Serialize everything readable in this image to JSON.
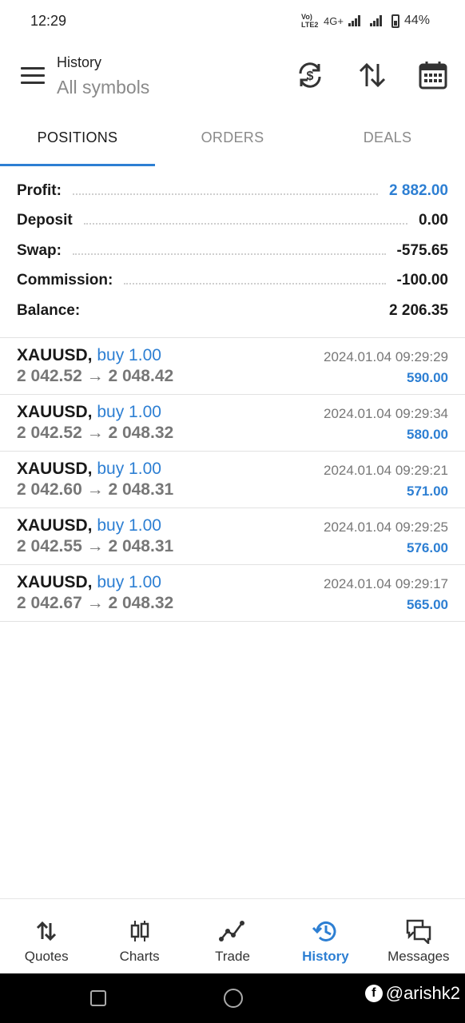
{
  "status_bar": {
    "time": "12:29",
    "network_label": "Vo) LTE2",
    "network_type": "4G+",
    "battery": "44%"
  },
  "header": {
    "title": "History",
    "subtitle": "All symbols"
  },
  "tabs": [
    {
      "label": "POSITIONS",
      "active": true
    },
    {
      "label": "ORDERS",
      "active": false
    },
    {
      "label": "DEALS",
      "active": false
    }
  ],
  "summary": {
    "profit_label": "Profit:",
    "profit_value": "2 882.00",
    "deposit_label": "Deposit",
    "deposit_value": "0.00",
    "swap_label": "Swap:",
    "swap_value": "-575.65",
    "commission_label": "Commission:",
    "commission_value": "-100.00",
    "balance_label": "Balance:",
    "balance_value": "2 206.35"
  },
  "deals": [
    {
      "symbol": "XAUUSD,",
      "type": "buy 1.00",
      "open": "2 042.52",
      "close": "2 048.42",
      "time": "2024.01.04 09:29:29",
      "profit": "590.00"
    },
    {
      "symbol": "XAUUSD,",
      "type": "buy 1.00",
      "open": "2 042.52",
      "close": "2 048.32",
      "time": "2024.01.04 09:29:34",
      "profit": "580.00"
    },
    {
      "symbol": "XAUUSD,",
      "type": "buy 1.00",
      "open": "2 042.60",
      "close": "2 048.31",
      "time": "2024.01.04 09:29:21",
      "profit": "571.00"
    },
    {
      "symbol": "XAUUSD,",
      "type": "buy 1.00",
      "open": "2 042.55",
      "close": "2 048.31",
      "time": "2024.01.04 09:29:25",
      "profit": "576.00"
    },
    {
      "symbol": "XAUUSD,",
      "type": "buy 1.00",
      "open": "2 042.67",
      "close": "2 048.32",
      "time": "2024.01.04 09:29:17",
      "profit": "565.00"
    }
  ],
  "arrow": "→",
  "bottom_nav": [
    {
      "label": "Quotes",
      "icon": "quotes-icon",
      "active": false
    },
    {
      "label": "Charts",
      "icon": "charts-icon",
      "active": false
    },
    {
      "label": "Trade",
      "icon": "trade-icon",
      "active": false
    },
    {
      "label": "History",
      "icon": "history-icon",
      "active": true
    },
    {
      "label": "Messages",
      "icon": "messages-icon",
      "active": false
    }
  ],
  "watermark": "@arishk2",
  "colors": {
    "accent": "#2d7fd3",
    "text": "#1a1a1a",
    "muted": "#777777"
  }
}
